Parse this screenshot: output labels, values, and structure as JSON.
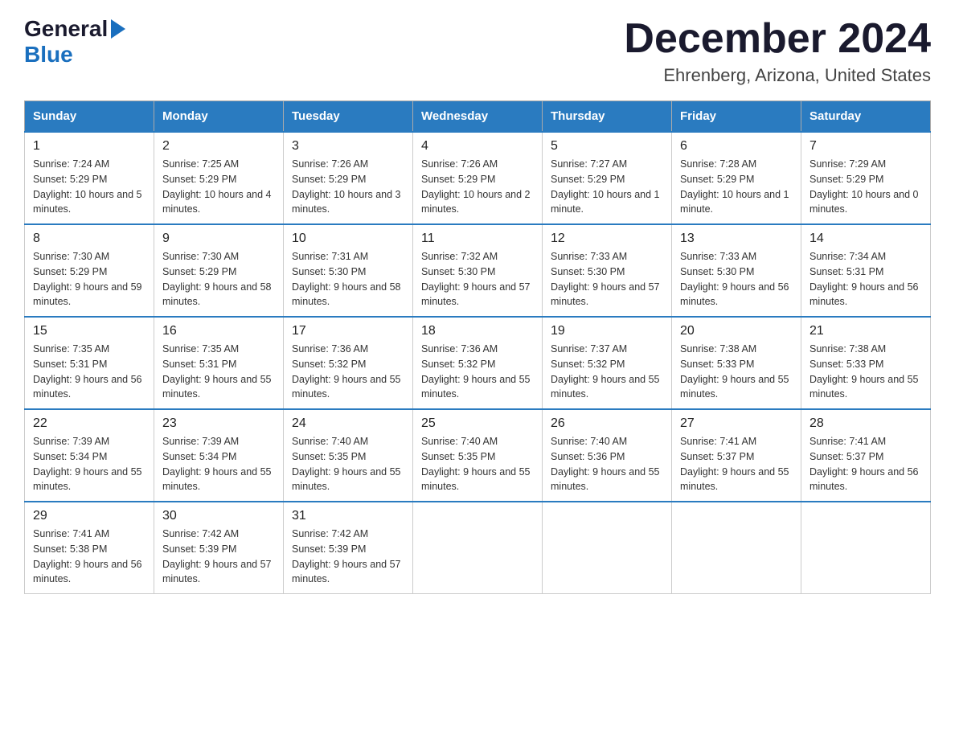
{
  "header": {
    "logo_general": "General",
    "logo_blue": "Blue",
    "title": "December 2024",
    "subtitle": "Ehrenberg, Arizona, United States"
  },
  "days_of_week": [
    "Sunday",
    "Monday",
    "Tuesday",
    "Wednesday",
    "Thursday",
    "Friday",
    "Saturday"
  ],
  "weeks": [
    [
      {
        "day": "1",
        "sunrise": "7:24 AM",
        "sunset": "5:29 PM",
        "daylight": "10 hours and 5 minutes."
      },
      {
        "day": "2",
        "sunrise": "7:25 AM",
        "sunset": "5:29 PM",
        "daylight": "10 hours and 4 minutes."
      },
      {
        "day": "3",
        "sunrise": "7:26 AM",
        "sunset": "5:29 PM",
        "daylight": "10 hours and 3 minutes."
      },
      {
        "day": "4",
        "sunrise": "7:26 AM",
        "sunset": "5:29 PM",
        "daylight": "10 hours and 2 minutes."
      },
      {
        "day": "5",
        "sunrise": "7:27 AM",
        "sunset": "5:29 PM",
        "daylight": "10 hours and 1 minute."
      },
      {
        "day": "6",
        "sunrise": "7:28 AM",
        "sunset": "5:29 PM",
        "daylight": "10 hours and 1 minute."
      },
      {
        "day": "7",
        "sunrise": "7:29 AM",
        "sunset": "5:29 PM",
        "daylight": "10 hours and 0 minutes."
      }
    ],
    [
      {
        "day": "8",
        "sunrise": "7:30 AM",
        "sunset": "5:29 PM",
        "daylight": "9 hours and 59 minutes."
      },
      {
        "day": "9",
        "sunrise": "7:30 AM",
        "sunset": "5:29 PM",
        "daylight": "9 hours and 58 minutes."
      },
      {
        "day": "10",
        "sunrise": "7:31 AM",
        "sunset": "5:30 PM",
        "daylight": "9 hours and 58 minutes."
      },
      {
        "day": "11",
        "sunrise": "7:32 AM",
        "sunset": "5:30 PM",
        "daylight": "9 hours and 57 minutes."
      },
      {
        "day": "12",
        "sunrise": "7:33 AM",
        "sunset": "5:30 PM",
        "daylight": "9 hours and 57 minutes."
      },
      {
        "day": "13",
        "sunrise": "7:33 AM",
        "sunset": "5:30 PM",
        "daylight": "9 hours and 56 minutes."
      },
      {
        "day": "14",
        "sunrise": "7:34 AM",
        "sunset": "5:31 PM",
        "daylight": "9 hours and 56 minutes."
      }
    ],
    [
      {
        "day": "15",
        "sunrise": "7:35 AM",
        "sunset": "5:31 PM",
        "daylight": "9 hours and 56 minutes."
      },
      {
        "day": "16",
        "sunrise": "7:35 AM",
        "sunset": "5:31 PM",
        "daylight": "9 hours and 55 minutes."
      },
      {
        "day": "17",
        "sunrise": "7:36 AM",
        "sunset": "5:32 PM",
        "daylight": "9 hours and 55 minutes."
      },
      {
        "day": "18",
        "sunrise": "7:36 AM",
        "sunset": "5:32 PM",
        "daylight": "9 hours and 55 minutes."
      },
      {
        "day": "19",
        "sunrise": "7:37 AM",
        "sunset": "5:32 PM",
        "daylight": "9 hours and 55 minutes."
      },
      {
        "day": "20",
        "sunrise": "7:38 AM",
        "sunset": "5:33 PM",
        "daylight": "9 hours and 55 minutes."
      },
      {
        "day": "21",
        "sunrise": "7:38 AM",
        "sunset": "5:33 PM",
        "daylight": "9 hours and 55 minutes."
      }
    ],
    [
      {
        "day": "22",
        "sunrise": "7:39 AM",
        "sunset": "5:34 PM",
        "daylight": "9 hours and 55 minutes."
      },
      {
        "day": "23",
        "sunrise": "7:39 AM",
        "sunset": "5:34 PM",
        "daylight": "9 hours and 55 minutes."
      },
      {
        "day": "24",
        "sunrise": "7:40 AM",
        "sunset": "5:35 PM",
        "daylight": "9 hours and 55 minutes."
      },
      {
        "day": "25",
        "sunrise": "7:40 AM",
        "sunset": "5:35 PM",
        "daylight": "9 hours and 55 minutes."
      },
      {
        "day": "26",
        "sunrise": "7:40 AM",
        "sunset": "5:36 PM",
        "daylight": "9 hours and 55 minutes."
      },
      {
        "day": "27",
        "sunrise": "7:41 AM",
        "sunset": "5:37 PM",
        "daylight": "9 hours and 55 minutes."
      },
      {
        "day": "28",
        "sunrise": "7:41 AM",
        "sunset": "5:37 PM",
        "daylight": "9 hours and 56 minutes."
      }
    ],
    [
      {
        "day": "29",
        "sunrise": "7:41 AM",
        "sunset": "5:38 PM",
        "daylight": "9 hours and 56 minutes."
      },
      {
        "day": "30",
        "sunrise": "7:42 AM",
        "sunset": "5:39 PM",
        "daylight": "9 hours and 57 minutes."
      },
      {
        "day": "31",
        "sunrise": "7:42 AM",
        "sunset": "5:39 PM",
        "daylight": "9 hours and 57 minutes."
      },
      null,
      null,
      null,
      null
    ]
  ],
  "labels": {
    "sunrise": "Sunrise:",
    "sunset": "Sunset:",
    "daylight": "Daylight:"
  }
}
